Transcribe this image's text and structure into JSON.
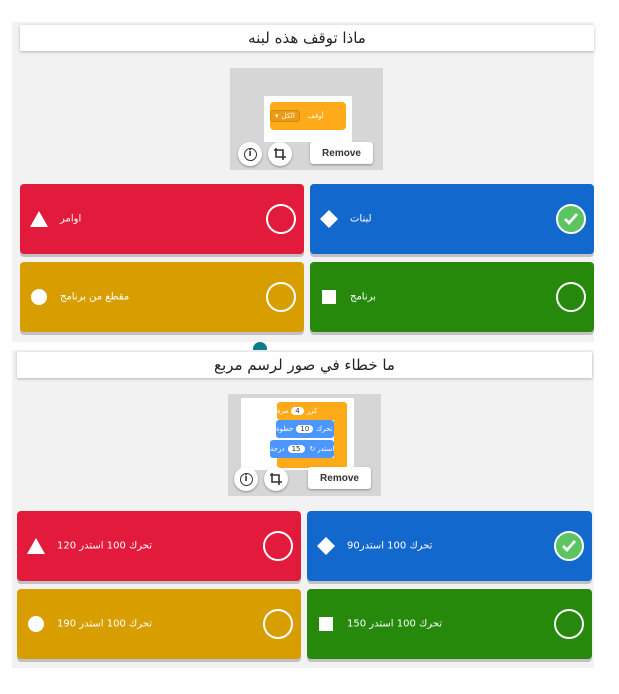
{
  "questions": [
    {
      "title": "ماذا توقف هذه لبنه",
      "media": {
        "remove_label": "Remove",
        "info_icon": "info-icon",
        "crop_icon": "crop-icon",
        "block_labels": [
          "أوقف",
          "الكل"
        ]
      },
      "answers": [
        {
          "label": "اوامر",
          "color": "#e21b3c",
          "shape": "triangle",
          "checked": false
        },
        {
          "label": "لبنات",
          "color": "#1368ce",
          "shape": "diamond",
          "checked": true
        },
        {
          "label": "مقطع من برنامج",
          "color": "#d89e00",
          "shape": "circle",
          "checked": false
        },
        {
          "label": "برنامج",
          "color": "#26890c",
          "shape": "square",
          "checked": false
        }
      ]
    },
    {
      "title": "ما خطاء في صور لرسم مربع",
      "media": {
        "remove_label": "Remove",
        "info_icon": "info-icon",
        "crop_icon": "crop-icon",
        "block_labels": [
          "كرر",
          "4",
          "مرة",
          "تحرك",
          "10",
          "خطوة",
          "استدر",
          "15",
          "درجة"
        ]
      },
      "answers": [
        {
          "label": "تحرك 100 استدر 120",
          "color": "#e21b3c",
          "shape": "triangle",
          "checked": false
        },
        {
          "label": "تحرك 100 استدر90",
          "color": "#1368ce",
          "shape": "diamond",
          "checked": true
        },
        {
          "label": "تحرك 100 استدر 190",
          "color": "#d89e00",
          "shape": "circle",
          "checked": false
        },
        {
          "label": "تحرك 100 استدر 150",
          "color": "#26890c",
          "shape": "square",
          "checked": false
        }
      ]
    }
  ]
}
